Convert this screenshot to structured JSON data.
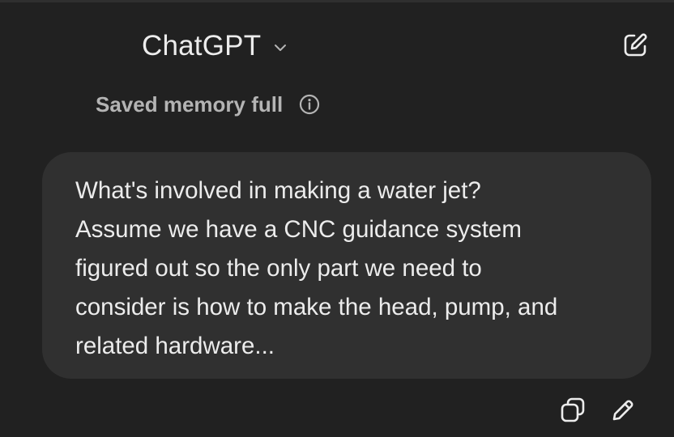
{
  "header": {
    "model_name": "ChatGPT",
    "chevron_icon": "chevron-down-icon",
    "new_chat_icon": "edit-square-icon"
  },
  "memory": {
    "status_text": "Saved memory full",
    "info_icon": "info-icon"
  },
  "message": {
    "role": "user",
    "text": "What's involved in making a water jet?\nAssume we have a CNC guidance system\nfigured out so the only part we need to\nconsider is how to make the head, pump, and\nrelated hardware..."
  },
  "message_actions": {
    "copy_icon": "copy-icon",
    "edit_icon": "pencil-icon"
  },
  "colors": {
    "background": "#212121",
    "bubble": "#303030",
    "text": "#ececec",
    "muted_text": "#b4b4b4"
  }
}
